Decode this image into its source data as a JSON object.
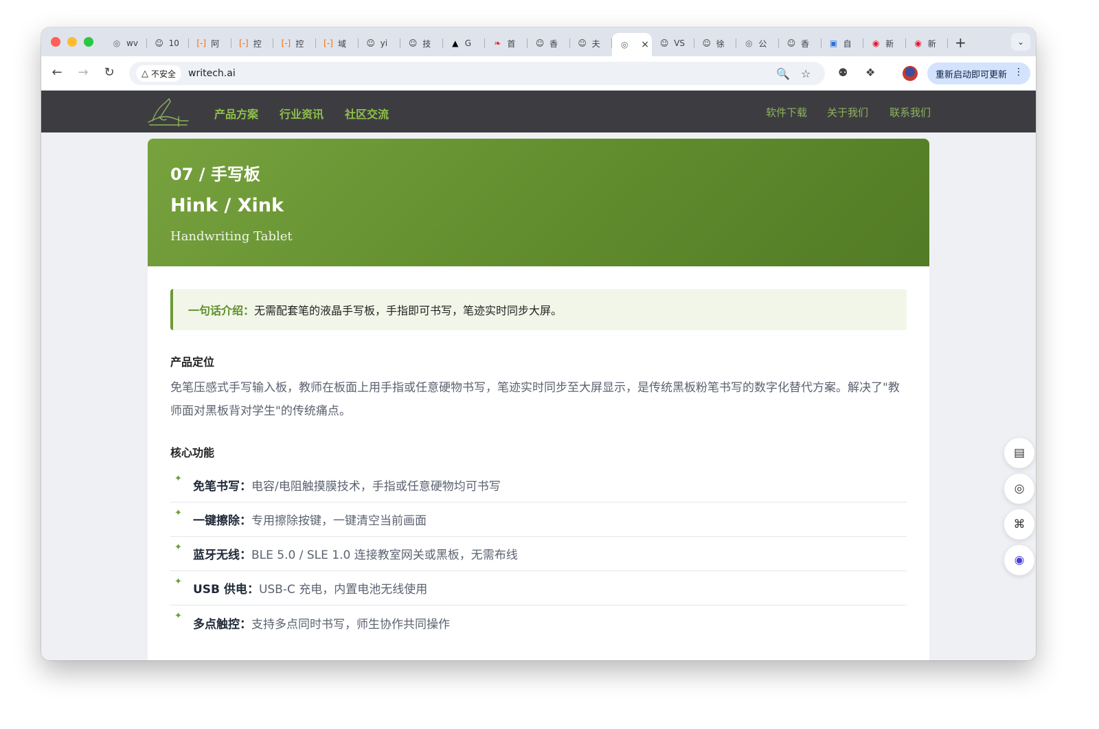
{
  "browser": {
    "tabs": [
      {
        "label": "wv",
        "icon": "globe-icon",
        "color": "#5f6368"
      },
      {
        "label": "10",
        "icon": "person-icon",
        "color": "#3b3b3b"
      },
      {
        "label": "阿",
        "icon": "bracket-icon",
        "color": "#ff6a00"
      },
      {
        "label": "控",
        "icon": "bracket-icon",
        "color": "#ff6a00"
      },
      {
        "label": "控",
        "icon": "bracket-icon",
        "color": "#ff6a00"
      },
      {
        "label": "域",
        "icon": "bracket-icon",
        "color": "#ff6a00"
      },
      {
        "label": "yi",
        "icon": "person-icon",
        "color": "#3b3b3b"
      },
      {
        "label": "技",
        "icon": "person-icon",
        "color": "#3b3b3b"
      },
      {
        "label": "G",
        "icon": "triangle-icon",
        "color": "#000000"
      },
      {
        "label": "首",
        "icon": "feather-icon",
        "color": "#d7261e"
      },
      {
        "label": "香",
        "icon": "person-icon",
        "color": "#3b3b3b"
      },
      {
        "label": "夫",
        "icon": "person-icon",
        "color": "#3b3b3b"
      },
      {
        "label": "",
        "icon": "globe-icon",
        "color": "#5f6368",
        "active": true
      },
      {
        "label": "VS",
        "icon": "person-icon",
        "color": "#3b3b3b"
      },
      {
        "label": "徐",
        "icon": "person-icon",
        "color": "#3b3b3b"
      },
      {
        "label": "公",
        "icon": "globe-icon",
        "color": "#5f6368"
      },
      {
        "label": "香",
        "icon": "person-icon",
        "color": "#3b3b3b"
      },
      {
        "label": "自",
        "icon": "box-icon",
        "color": "#2f6fd6"
      },
      {
        "label": "新",
        "icon": "weibo-icon",
        "color": "#e6162d"
      },
      {
        "label": "新",
        "icon": "weibo-icon",
        "color": "#e6162d"
      }
    ],
    "active_close": "×",
    "new_tab": "+",
    "insecure_label": "不安全",
    "url": "writech.ai",
    "update_label": "重新启动即可更新"
  },
  "site": {
    "nav_left": [
      "产品方案",
      "行业资讯",
      "社区交流"
    ],
    "nav_right": [
      "软件下载",
      "关于我们",
      "联系我们"
    ]
  },
  "product": {
    "number_title": "07 / 手写板",
    "name": "Hink / Xink",
    "subtitle": "Handwriting Tablet",
    "intro_lead": "一句话介绍：",
    "intro_text": "无需配套笔的液晶手写板，手指即可书写，笔迹实时同步大屏。",
    "positioning_title": "产品定位",
    "positioning_text": "免笔压感式手写输入板，教师在板面上用手指或任意硬物书写，笔迹实时同步至大屏显示，是传统黑板粉笔书写的数字化替代方案。解决了\"教师面对黑板背对学生\"的传统痛点。",
    "features_title": "核心功能",
    "features": [
      {
        "name": "免笔书写",
        "text": "电容/电阻触摸膜技术，手指或任意硬物均可书写"
      },
      {
        "name": "一键擦除",
        "text": "专用擦除按键，一键清空当前画面"
      },
      {
        "name": "蓝牙无线",
        "text": "BLE 5.0 / SLE 1.0 连接教室网关或黑板，无需布线"
      },
      {
        "name": "USB 供电",
        "text": "USB-C 充电，内置电池无线使用"
      },
      {
        "name": "多点触控",
        "text": "支持多点同时书写，师生协作共同操作"
      }
    ]
  },
  "colors": {
    "accent": "#6b9a34",
    "nav_bg": "#3d3d41",
    "hero_bg": "#6a9636"
  }
}
